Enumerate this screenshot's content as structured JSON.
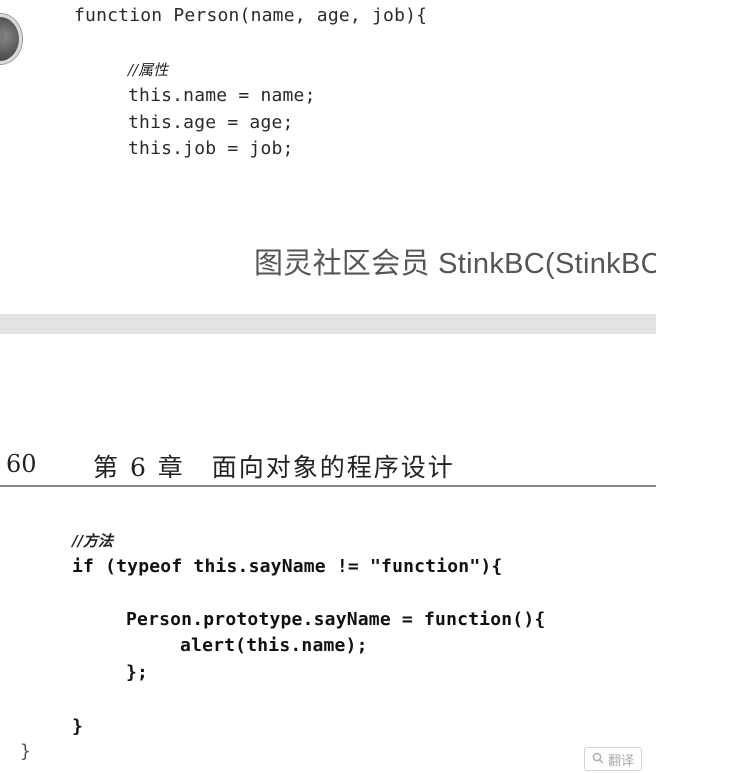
{
  "top_code": {
    "signature": "function Person(name, age, job){",
    "comment": "//属性",
    "line_name": "this.name = name;",
    "line_age": "this.age = age;",
    "line_job": "this.job = job;"
  },
  "watermark": "图灵社区会员 StinkBC(StinkBC",
  "page_header": {
    "page_number": "60",
    "chapter": "第 6 章　面向对象的程序设计"
  },
  "bottom_code": {
    "comment": "//方法",
    "if_line": "if (typeof this.sayName != \"function\"){",
    "proto_line": "Person.prototype.sayName = function(){",
    "alert_line": "alert(this.name);",
    "close_fn": "};",
    "close_if": "}",
    "close_outer": "}"
  },
  "translate_button": {
    "icon": "search-icon",
    "label": "翻译"
  }
}
